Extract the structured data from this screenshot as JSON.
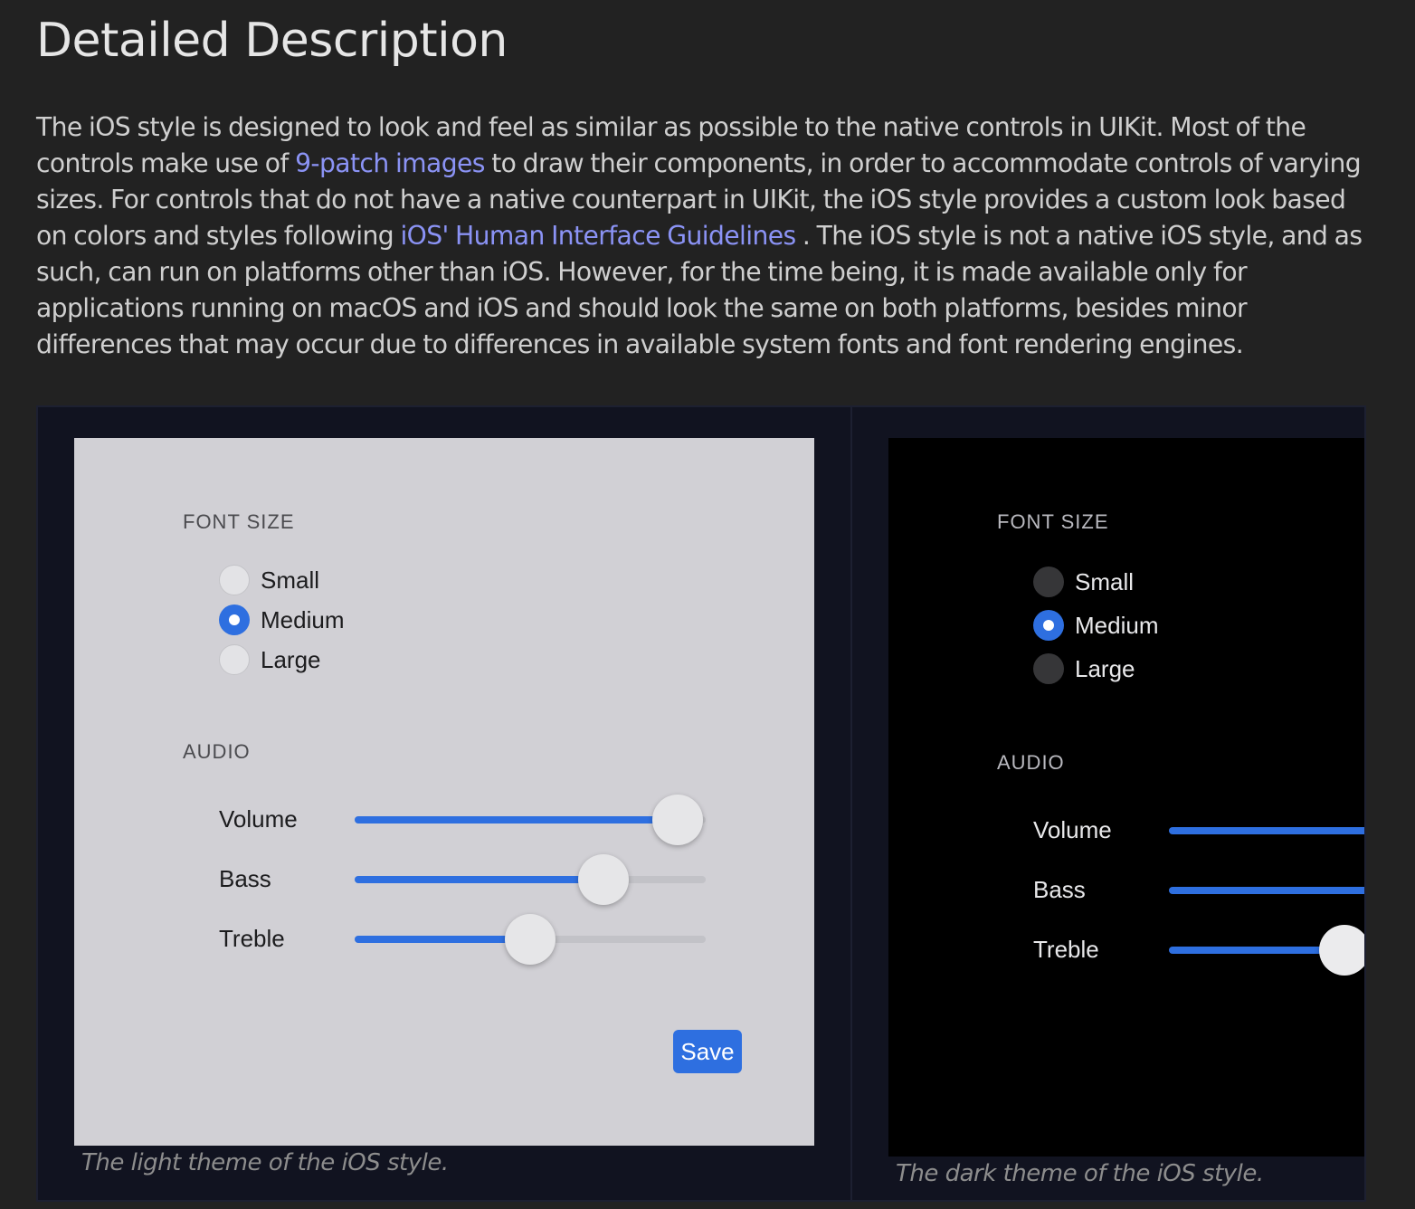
{
  "heading": "Detailed Description",
  "description": {
    "p1": "The iOS style is designed to look and feel as similar as possible to the native controls in UIKit. Most of the controls make use of ",
    "link1": "9-patch images",
    "p2": " to draw their components, in order to accommodate controls of varying sizes. For controls that do not have a native counterpart in UIKit, the iOS style provides a custom look based on colors and styles following ",
    "link2": "iOS' Human Interface Guidelines",
    "p3": " . The iOS style is not a native iOS style, and as such, can run on platforms other than iOS. However, for the time being, it is made available only for applications running on macOS and iOS and should look the same on both platforms, besides minor differences that may occur due to differences in available system fonts and font rendering engines."
  },
  "colors": {
    "page_bg": "#222222",
    "link": "#8b93f5",
    "accent": "#2e6fe0",
    "light_theme_bg": "#d1d0d5",
    "dark_theme_bg": "#000000"
  },
  "light": {
    "font_size_heading": "FONT SIZE",
    "options": [
      "Small",
      "Medium",
      "Large"
    ],
    "selected": "Medium",
    "audio_heading": "AUDIO",
    "sliders": [
      {
        "label": "Volume",
        "value": 0.92
      },
      {
        "label": "Bass",
        "value": 0.71
      },
      {
        "label": "Treble",
        "value": 0.5
      }
    ],
    "save_label": "Save",
    "caption": "The light theme of the iOS style."
  },
  "dark": {
    "font_size_heading": "FONT SIZE",
    "options": [
      "Small",
      "Medium",
      "Large"
    ],
    "selected": "Medium",
    "audio_heading": "AUDIO",
    "sliders": [
      {
        "label": "Volume"
      },
      {
        "label": "Bass"
      },
      {
        "label": "Treble"
      }
    ],
    "caption": "The dark theme of the iOS style."
  }
}
